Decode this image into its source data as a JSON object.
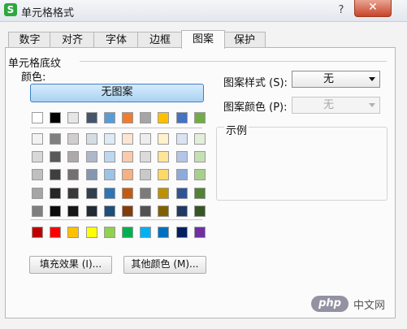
{
  "window": {
    "app_logo": "S",
    "title": "单元格格式",
    "help_label": "?",
    "close_label": "✕"
  },
  "tabs": [
    "数字",
    "对齐",
    "字体",
    "边框",
    "图案",
    "保护"
  ],
  "active_tab": 4,
  "shading": {
    "group_title": "单元格底纹",
    "color_label": "颜色:",
    "no_pattern_label": "无图案",
    "palette_top": [
      "#ffffff",
      "#000000",
      "#e7e6e6",
      "#44546a",
      "#5b9bd5",
      "#ed7d31",
      "#a5a5a5",
      "#ffc000",
      "#4472c4",
      "#70ad47"
    ],
    "palette_shades": [
      [
        "#f2f2f2",
        "#7f7f7f",
        "#d0cece",
        "#d6dce4",
        "#deebf6",
        "#fbe5d5",
        "#ededed",
        "#fff2cc",
        "#dae3f3",
        "#e2efd9"
      ],
      [
        "#d8d8d8",
        "#595959",
        "#aeaaaa",
        "#adb9ca",
        "#bdd7ee",
        "#f7cbac",
        "#dbdbdb",
        "#fee599",
        "#b4c6e7",
        "#c5e0b3"
      ],
      [
        "#bfbfbf",
        "#3f3f3f",
        "#757070",
        "#8496b0",
        "#9cc3e5",
        "#f4b183",
        "#c9c9c9",
        "#ffd965",
        "#8eaadb",
        "#a8d08d"
      ],
      [
        "#a5a5a5",
        "#262626",
        "#3a3838",
        "#323f4f",
        "#2e75b5",
        "#c55a11",
        "#7b7b7b",
        "#bf9000",
        "#2f5496",
        "#538135"
      ],
      [
        "#7f7f7f",
        "#0c0c0c",
        "#171616",
        "#222a35",
        "#1e4e79",
        "#833c0b",
        "#525252",
        "#7f6000",
        "#1f3864",
        "#375623"
      ]
    ],
    "palette_standard": [
      "#c00000",
      "#ff0000",
      "#ffc000",
      "#ffff00",
      "#92d050",
      "#00b050",
      "#00b0f0",
      "#0070c0",
      "#002060",
      "#7030a0"
    ],
    "fill_effects_label": "填充效果 (I)...",
    "more_colors_label": "其他颜色 (M)..."
  },
  "pattern": {
    "style_label": "图案样式 (S):",
    "style_value": "无",
    "color_label": "图案颜色 (P):",
    "color_value": "无",
    "sample_label": "示例"
  },
  "watermark": {
    "logo": "php",
    "text": "中文网"
  }
}
